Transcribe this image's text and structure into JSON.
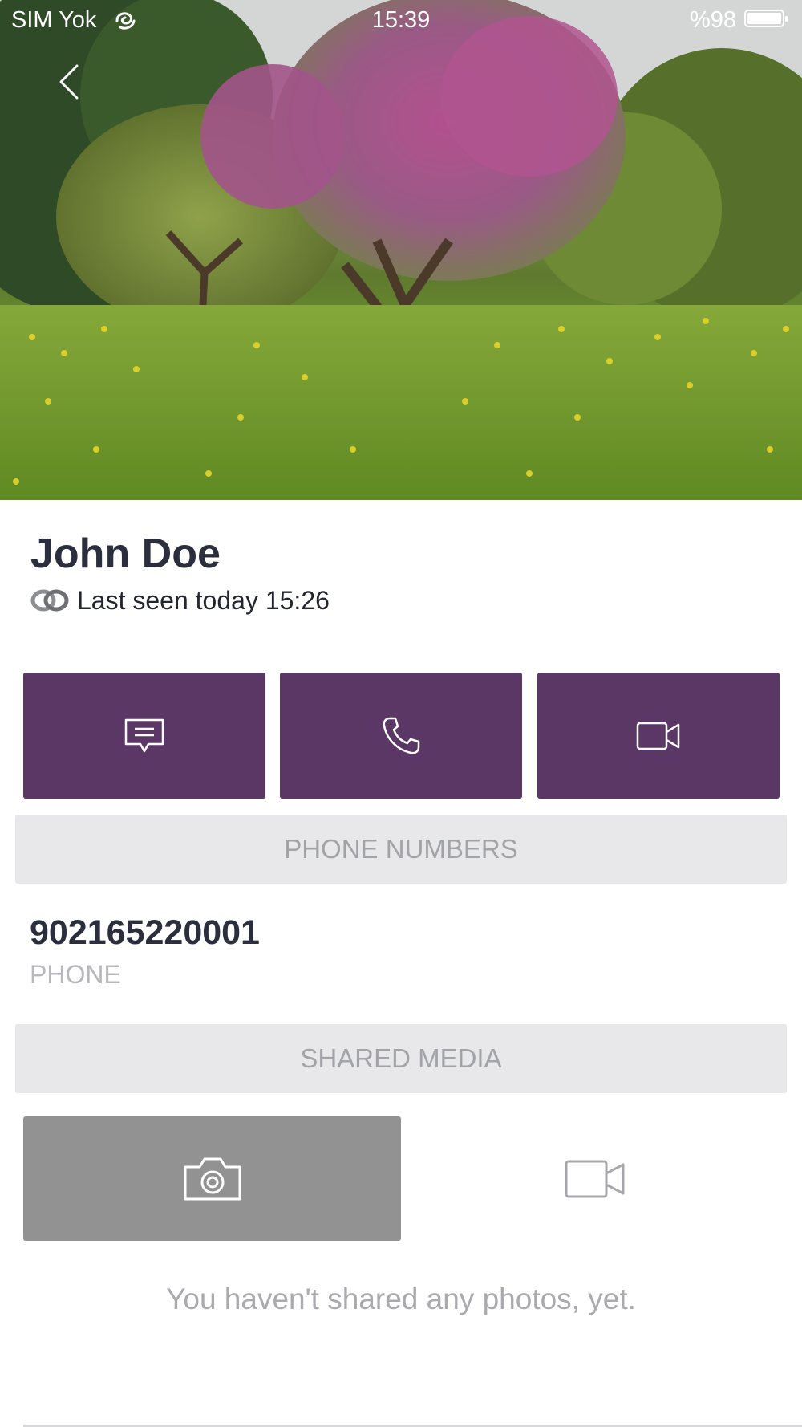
{
  "status_bar": {
    "carrier": "SIM Yok",
    "time": "15:39",
    "battery_percent": "%98"
  },
  "header": {
    "back_icon": "chevron-left-icon"
  },
  "profile": {
    "name": "John Doe",
    "status_icon": "viber-online-icon",
    "last_seen": "Last seen today 15:26"
  },
  "actions": [
    {
      "name": "message",
      "icon": "message-icon"
    },
    {
      "name": "call",
      "icon": "phone-icon"
    },
    {
      "name": "video-call",
      "icon": "video-camera-icon"
    }
  ],
  "phone_section": {
    "title": "PHONE NUMBERS",
    "number": "902165220001",
    "type": "PHONE"
  },
  "media_section": {
    "title": "SHARED MEDIA",
    "tabs": [
      {
        "label": "photos",
        "icon": "camera-icon",
        "selected": true
      },
      {
        "label": "videos",
        "icon": "video-camera-icon",
        "selected": false
      }
    ],
    "empty_message": "You haven't shared any photos, yet."
  },
  "colors": {
    "accent": "#5b3766",
    "section_bg": "#e8e8ea",
    "selected_tab": "#929292"
  }
}
